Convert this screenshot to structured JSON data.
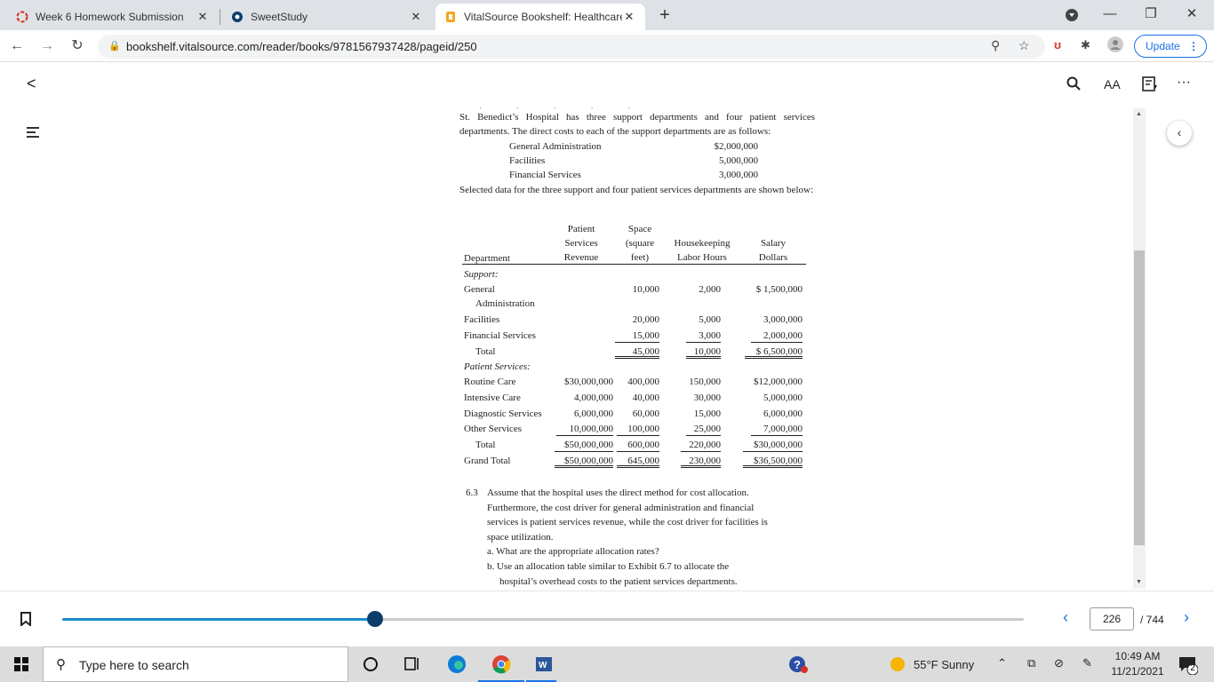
{
  "browser": {
    "tabs": [
      {
        "title": "Week 6 Homework Submission",
        "active": false
      },
      {
        "title": "SweetStudy",
        "active": false
      },
      {
        "title": "VitalSource Bookshelf: Healthcare",
        "active": true
      }
    ],
    "new_tab_label": "+",
    "url": "bookshelf.vitalsource.com/reader/books/9781567937428/pageid/250",
    "update_label": "Update",
    "colors": {
      "accent": "#1a73e8",
      "tab_strip": "#dee1e6"
    }
  },
  "reader": {
    "back_label": "<",
    "search_icon": "search-icon",
    "text_size_label": "AA",
    "more_label": "···"
  },
  "book": {
    "intro": "St. Benedict’s Hospital has three support departments and four patient services departments. The direct costs to each of the support departments are as follows:",
    "direct_costs": [
      {
        "label": "General Administration",
        "value": "$2,000,000"
      },
      {
        "label": "Facilities",
        "value": "5,000,000"
      },
      {
        "label": "Financial Services",
        "value": "3,000,000"
      }
    ],
    "selected_text": "Selected data for the three support and four patient services departments are shown below:",
    "table": {
      "headers": {
        "department": "Department",
        "revenue": [
          "Patient",
          "Services",
          "Revenue"
        ],
        "space": [
          "Space",
          "(square",
          "feet)"
        ],
        "housekeeping": [
          "Housekeeping",
          "Labor Hours"
        ],
        "salary": [
          "Salary",
          "Dollars"
        ]
      },
      "support_label": "Support:",
      "support_rows": [
        {
          "dept": "General",
          "dept2": "Administration",
          "revenue": "",
          "space": "10,000",
          "hours": "2,000",
          "salary": "$ 1,500,000"
        },
        {
          "dept": "Facilities",
          "revenue": "",
          "space": "20,000",
          "hours": "5,000",
          "salary": "3,000,000"
        },
        {
          "dept": "Financial Services",
          "revenue": "",
          "space": "15,000",
          "hours": "3,000",
          "salary": "2,000,000"
        },
        {
          "dept": "Total",
          "revenue": "",
          "space": "45,000",
          "hours": "10,000",
          "salary": "$ 6,500,000"
        }
      ],
      "patient_label": "Patient Services:",
      "patient_rows": [
        {
          "dept": "Routine Care",
          "revenue": "$30,000,000",
          "space": "400,000",
          "hours": "150,000",
          "salary": "$12,000,000"
        },
        {
          "dept": "Intensive Care",
          "revenue": "4,000,000",
          "space": "40,000",
          "hours": "30,000",
          "salary": "5,000,000"
        },
        {
          "dept": "Diagnostic Services",
          "revenue": "6,000,000",
          "space": "60,000",
          "hours": "15,000",
          "salary": "6,000,000"
        },
        {
          "dept": "Other Services",
          "revenue": "10,000,000",
          "space": "100,000",
          "hours": "25,000",
          "salary": "7,000,000"
        },
        {
          "dept": "Total",
          "revenue": "$50,000,000",
          "space": "600,000",
          "hours": "220,000",
          "salary": "$30,000,000"
        },
        {
          "dept": "Grand Total",
          "revenue": "$50,000,000",
          "space": "645,000",
          "hours": "230,000",
          "salary": "$36,500,000"
        }
      ]
    },
    "question": {
      "number": "6.3",
      "lines": [
        "Assume that the hospital uses the direct method for cost allocation.",
        "Furthermore, the cost driver for general administration and financial",
        "services is patient services revenue, while the cost driver for facilities is",
        "space utilization."
      ],
      "part_a": "a. What are the appropriate allocation rates?",
      "part_b_lines": [
        "b. Use an allocation table similar to Exhibit 6.7 to allocate the",
        "hospital’s overhead costs to the patient services departments."
      ]
    }
  },
  "pager": {
    "current_page": "226",
    "total": "/ 744",
    "progress": 0.325
  },
  "taskbar": {
    "search_placeholder": "Type here to search",
    "weather": "55°F  Sunny",
    "time": "10:49 AM",
    "date": "11/21/2021",
    "notifications": "2"
  }
}
